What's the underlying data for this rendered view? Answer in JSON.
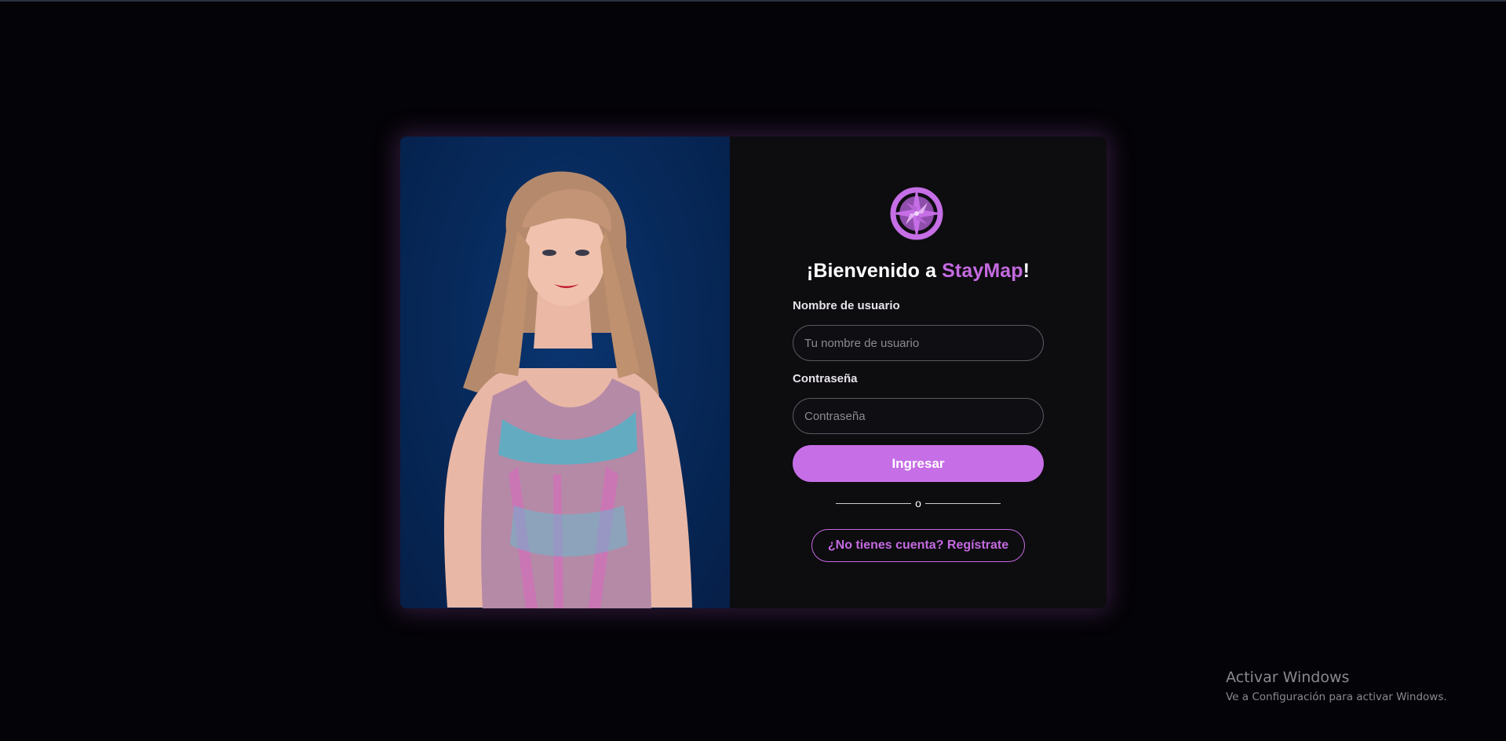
{
  "login": {
    "title_prefix": "¡Bienvenido a ",
    "title_brand": "StayMap",
    "title_suffix": "!",
    "username_label": "Nombre de usuario",
    "username_placeholder": "Tu nombre de usuario",
    "username_value": "",
    "password_label": "Contraseña",
    "password_placeholder": "Contraseña",
    "password_value": "",
    "submit_label": "Ingresar",
    "divider_text": "o",
    "register_label": "¿No tienes cuenta? Regístrate"
  },
  "icons": {
    "logo": "compass-rose-icon"
  },
  "colors": {
    "accent": "#c66ee6",
    "background": "#040307",
    "panel": "#0d0c0f",
    "photo_background": "#072a5c"
  },
  "watermark": {
    "title": "Activar Windows",
    "subtitle": "Ve a Configuración para activar Windows."
  }
}
